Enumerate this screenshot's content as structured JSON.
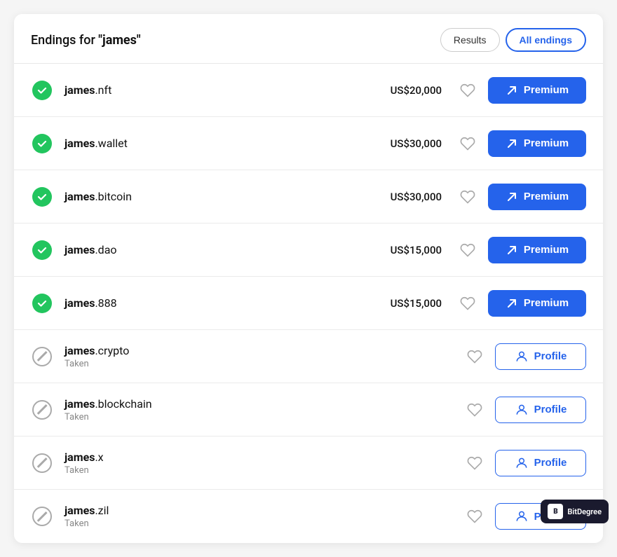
{
  "header": {
    "title_prefix": "Endings for ",
    "search_term": "\"james\"",
    "btn_results": "Results",
    "btn_all_endings": "All endings"
  },
  "domains": [
    {
      "id": "james-nft",
      "base": "james",
      "ext": ".nft",
      "status": "available",
      "price": "US$20,000",
      "action": "premium",
      "action_label": "Premium",
      "taken_label": null
    },
    {
      "id": "james-wallet",
      "base": "james",
      "ext": ".wallet",
      "status": "available",
      "price": "US$30,000",
      "action": "premium",
      "action_label": "Premium",
      "taken_label": null
    },
    {
      "id": "james-bitcoin",
      "base": "james",
      "ext": ".bitcoin",
      "status": "available",
      "price": "US$30,000",
      "action": "premium",
      "action_label": "Premium",
      "taken_label": null
    },
    {
      "id": "james-dao",
      "base": "james",
      "ext": ".dao",
      "status": "available",
      "price": "US$15,000",
      "action": "premium",
      "action_label": "Premium",
      "taken_label": null
    },
    {
      "id": "james-888",
      "base": "james",
      "ext": ".888",
      "status": "available",
      "price": "US$15,000",
      "action": "premium",
      "action_label": "Premium",
      "taken_label": null
    },
    {
      "id": "james-crypto",
      "base": "james",
      "ext": ".crypto",
      "status": "taken",
      "price": null,
      "action": "profile",
      "action_label": "Profile",
      "taken_label": "Taken"
    },
    {
      "id": "james-blockchain",
      "base": "james",
      "ext": ".blockchain",
      "status": "taken",
      "price": null,
      "action": "profile",
      "action_label": "Profile",
      "taken_label": "Taken"
    },
    {
      "id": "james-x",
      "base": "james",
      "ext": ".x",
      "status": "taken",
      "price": null,
      "action": "profile",
      "action_label": "Profile",
      "taken_label": "Taken"
    },
    {
      "id": "james-zil",
      "base": "james",
      "ext": ".zil",
      "status": "taken",
      "price": null,
      "action": "profile",
      "action_label": "Profile",
      "taken_label": "Taken"
    }
  ],
  "badge": {
    "logo": "B",
    "label": "BitDegree"
  }
}
